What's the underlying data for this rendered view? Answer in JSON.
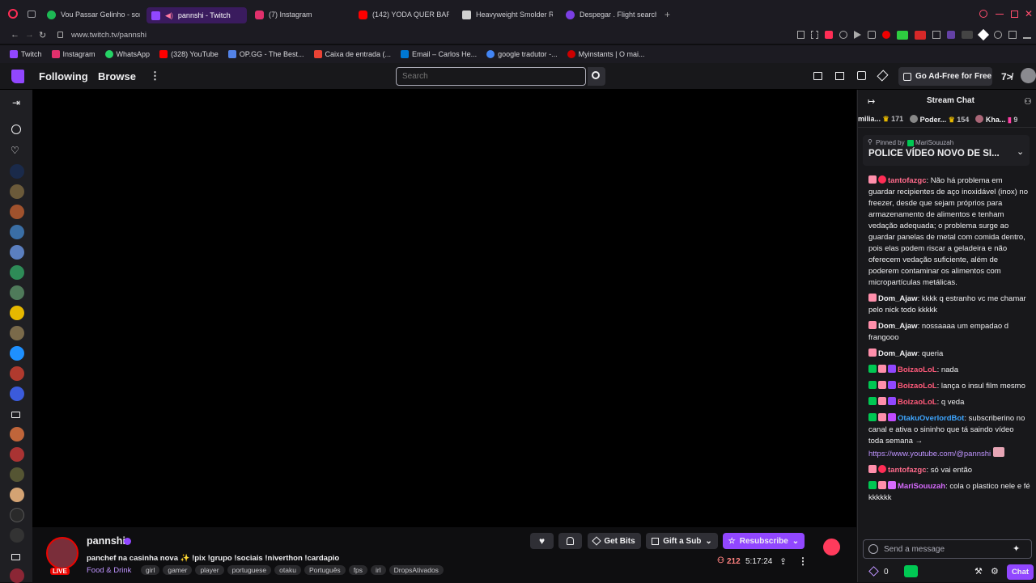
{
  "browser": {
    "tabs": [
      {
        "label": "Vou Passar Gelinho - son",
        "color": "#1db954"
      },
      {
        "label": "pannshi - Twitch",
        "color": "#9147ff"
      },
      {
        "label": "(7) Instagram",
        "color": "#e1306c"
      },
      {
        "label": "(142) YODA QUER BARRA",
        "color": "#ff0000"
      },
      {
        "label": "Heavyweight Smolder Re",
        "color": "#ffffff"
      },
      {
        "label": "Despegar . Flight search",
        "color": "#7b3fe4"
      }
    ],
    "url": "www.twitch.tv/pannshi",
    "bookmarks": [
      {
        "label": "Twitch",
        "color": "#9147ff"
      },
      {
        "label": "Instagram",
        "color": "#e1306c"
      },
      {
        "label": "WhatsApp",
        "color": "#25d366"
      },
      {
        "label": "(328) YouTube",
        "color": "#ff0000"
      },
      {
        "label": "OP.GG - The Best...",
        "color": "#5383e8"
      },
      {
        "label": "Caixa de entrada (...",
        "color": "#ea4335"
      },
      {
        "label": "Email – Carlos He...",
        "color": "#0078d4"
      },
      {
        "label": "google tradutor -...",
        "color": "#4285f4"
      },
      {
        "label": "Myinstants | O mai...",
        "color": "#c00"
      }
    ]
  },
  "nav": {
    "following": "Following",
    "browse": "Browse",
    "search_placeholder": "Search",
    "ad_free": "Go Ad-Free for Free"
  },
  "channel": {
    "name": "pannshi",
    "title": "panchef na casinha nova ✨ !pix !grupo !sociais !niverthon !cardapio",
    "category": "Food & Drink",
    "tags": [
      "girl",
      "gamer",
      "player",
      "portuguese",
      "otaku",
      "Português",
      "fps",
      "irl",
      "DropsAtivados"
    ],
    "live": "LIVE",
    "viewers": "212",
    "uptime": "5:17:24",
    "get_bits": "Get Bits",
    "gift_sub": "Gift a Sub",
    "resubscribe": "Resubscribe"
  },
  "chat": {
    "header": "Stream Chat",
    "leaderboard": [
      {
        "name": "milia...",
        "value": "171"
      },
      {
        "name": "Poder...",
        "value": "154"
      },
      {
        "name": "Kha...",
        "value": "9"
      }
    ],
    "pinned_by": "Pinned by",
    "pinned_user": "MariSouuzah",
    "pinned_text": "POLICE VÍDEO NOVO DE SI...",
    "messages": [
      {
        "user": "tantofazgc",
        "color": "#ff6b8b",
        "text": "Não há problema em guardar recipientes de aço inoxidável (inox) no freezer, desde que sejam próprios para armazenamento de alimentos e tenham vedação adequada; o problema surge ao guardar panelas de metal com comida dentro, pois elas podem riscar a geladeira e não oferecem vedação suficiente, além de poderem contaminar os alimentos com micropartículas metálicas."
      },
      {
        "user": "Dom_Ajaw",
        "color": "#efeff1",
        "text": "kkkk q estranho vc me chamar pelo nick todo kkkkk"
      },
      {
        "user": "Dom_Ajaw",
        "color": "#efeff1",
        "text": "nossaaaa um empadao d frangooo"
      },
      {
        "user": "Dom_Ajaw",
        "color": "#efeff1",
        "text": "queria"
      },
      {
        "user": "BoizaoLoL",
        "color": "#ff5a7a",
        "text": "nada"
      },
      {
        "user": "BoizaoLoL",
        "color": "#ff5a7a",
        "text": "lança o insul film mesmo"
      },
      {
        "user": "BoizaoLoL",
        "color": "#ff5a7a",
        "text": "q veda"
      },
      {
        "user": "OtakuOverlordBot",
        "color": "#3ea6ff",
        "text": "subscriberino no canal e ativa o sininho que tá saindo vídeo toda semana →",
        "link": "https://www.youtube.com/@pannshi"
      },
      {
        "user": "tantofazgc",
        "color": "#ff6b8b",
        "text": "só vai então"
      },
      {
        "user": "MariSouuzah",
        "color": "#d86bff",
        "text": "cola o plastico nele e fé kkkkkk"
      }
    ],
    "input_placeholder": "Send a message",
    "points": "0",
    "chat_button": "Chat"
  }
}
